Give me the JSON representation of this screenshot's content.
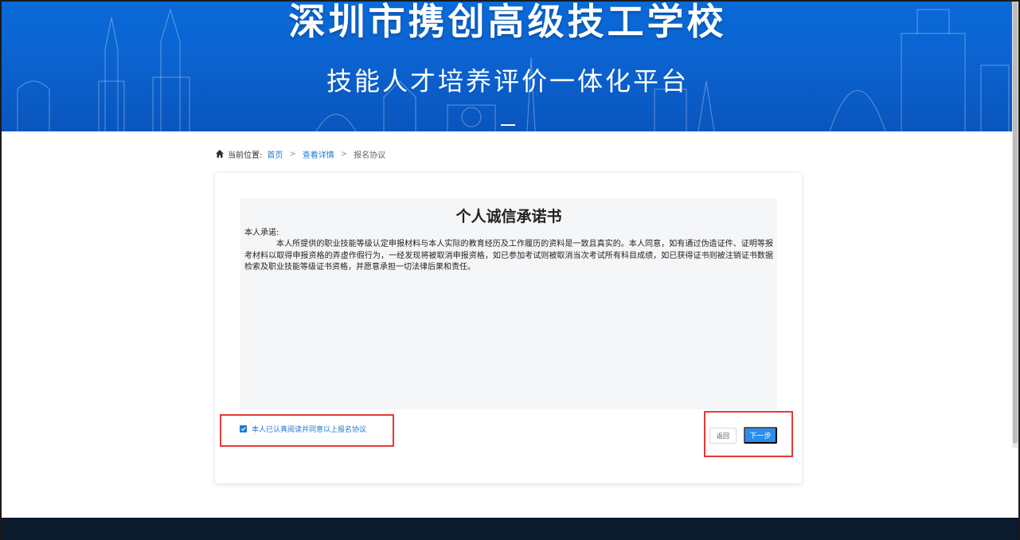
{
  "banner": {
    "title": "深圳市携创高级技工学校",
    "subtitle": "技能人才培养评价一体化平台"
  },
  "breadcrumb": {
    "prefix": "当前位置:",
    "home": "首页",
    "detail": "查看详情",
    "current": "报名协议",
    "separator": ">"
  },
  "document": {
    "title": "个人诚信承诺书",
    "lead": "本人承诺:",
    "body": "本人所提供的职业技能等级认定申报材料与本人实际的教育经历及工作履历的资料是一致且真实的。本人同意，如有通过伪造证件、证明等报考材料以取得申报资格的弄虚作假行为，一经发现将被取消申报资格，如已参加考试则被取消当次考试所有科目成绩，如已获得证书则被注销证书数据检索及职业技能等级证书资格，并愿意承担一切法律后果和责任。"
  },
  "agreement": {
    "label": "本人已认真阅读并同意以上报名协议",
    "checked": true
  },
  "actions": {
    "back_label": "返回",
    "next_label": "下一步"
  },
  "colors": {
    "banner_blue": "#0b63d0",
    "link_blue": "#1e7ad6",
    "primary_button": "#2a8ef0",
    "highlight_red": "#e53935",
    "footer": "#0c1a2e"
  }
}
